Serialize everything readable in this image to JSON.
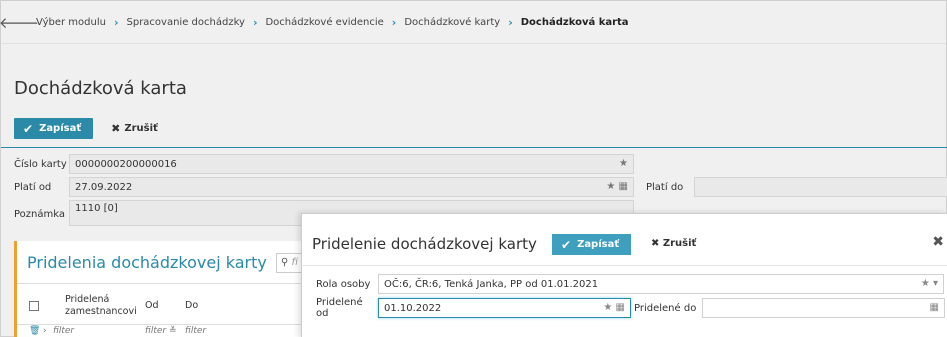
{
  "breadcrumb": {
    "back_icon": "arrow-left-icon",
    "items": [
      "Výber modulu",
      "Spracovanie dochádzky",
      "Dochádzkové evidencie",
      "Dochádzkové karty",
      "Dochádzková karta"
    ]
  },
  "page": {
    "title": "Dochádzková karta"
  },
  "toolbar": {
    "save_label": "Zapísať",
    "cancel_label": "Zrušiť"
  },
  "form": {
    "card_number_label": "Číslo karty",
    "card_number_value": "0000000200000016",
    "valid_from_label": "Platí od",
    "valid_from_value": "27.09.2022",
    "valid_to_label": "Platí do",
    "valid_to_value": "",
    "note_label": "Poznámka",
    "note_value": "1110 [0]"
  },
  "panel": {
    "title": "Pridelenia dochádzkovej karty",
    "search_placeholder": "fi",
    "columns": [
      "Pridelená zamestnancovi",
      "Od",
      "Do"
    ],
    "filters": [
      "filter",
      "filter",
      "filter"
    ]
  },
  "dialog": {
    "title": "Pridelenie dochádzkovej karty",
    "save_label": "Zapísať",
    "cancel_label": "Zrušiť",
    "role_label": "Rola osoby",
    "role_value": "OČ:6, ČR:6, Tenká Janka, PP od 01.01.2021",
    "assigned_from_label": "Pridelené od",
    "assigned_from_value": "01.10.2022",
    "assigned_to_label": "Pridelené do",
    "assigned_to_value": ""
  },
  "colors": {
    "accent": "#2a8aa8",
    "panel_border": "#f0a030"
  }
}
